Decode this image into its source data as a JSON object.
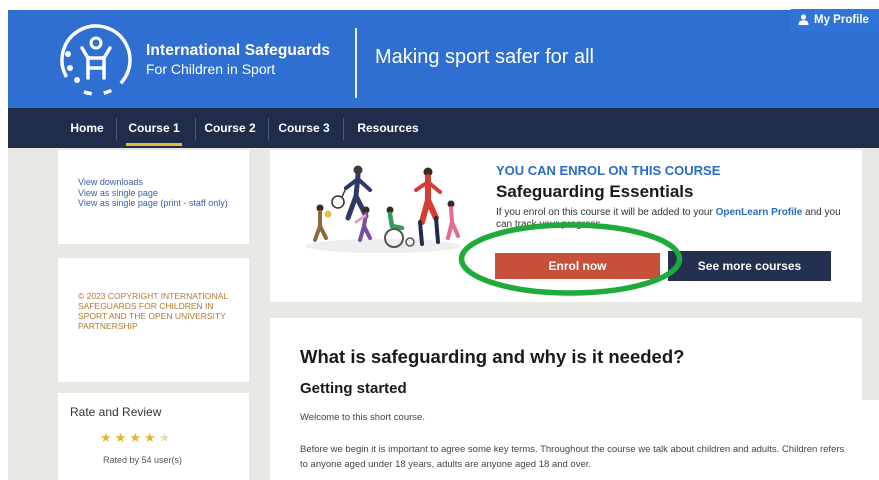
{
  "header": {
    "brand_line1": "International Safeguards",
    "brand_line2": "For Children in Sport",
    "tagline": "Making sport safer for all",
    "color": "#2e6fd1"
  },
  "nav": {
    "items": [
      {
        "label": "Home",
        "active": false
      },
      {
        "label": "Course 1",
        "active": true
      },
      {
        "label": "Course 2",
        "active": false
      },
      {
        "label": "Course 3",
        "active": false
      },
      {
        "label": "Resources",
        "active": false
      }
    ],
    "profile_label": "My Profile",
    "active_underline_color": "#e8b839"
  },
  "sidebar": {
    "links": [
      "View downloads",
      "View as single page",
      "View as single page (print - staff only)"
    ],
    "copyright": "© 2023 COPYRIGHT INTERNATIONAL SAFEGUARDS FOR CHILDREN IN SPORT AND THE OPEN UNIVERSITY PARTNERSHIP",
    "rate": {
      "title": "Rate and Review",
      "stars_filled": 4,
      "stars_total": 5,
      "rated_text": "Rated by 54 user(s)"
    }
  },
  "course": {
    "kicker": "YOU CAN ENROL ON THIS COURSE",
    "title": "Safeguarding Essentials",
    "desc_before": "If you enrol on this course it will be added to your ",
    "desc_link": "OpenLearn Profile",
    "desc_after": " and you can track your progress.",
    "enrol_label": "Enrol now",
    "more_label": "See more courses",
    "highlight_color": "#1eab3c"
  },
  "article": {
    "heading": "What is safeguarding and why is it needed?",
    "subheading": "Getting started",
    "p1": "Welcome to this short course.",
    "p2": "Before we begin it is important to agree some key terms. Throughout the course we talk about children and adults. Children refers to anyone aged under 18 years, adults are anyone aged 18 and over."
  }
}
